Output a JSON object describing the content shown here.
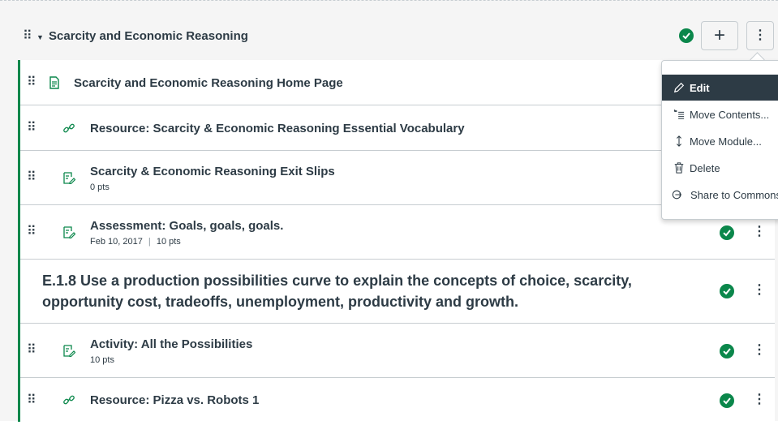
{
  "module": {
    "title": "Scarcity and Economic Reasoning",
    "add_label": "+",
    "more_label": "⋮"
  },
  "items": [
    {
      "title": "Scarcity and Economic Reasoning Home Page",
      "type": "page-icon",
      "meta": ""
    },
    {
      "title": "Resource: Scarcity & Economic Reasoning Essential Vocabulary",
      "type": "link-icon",
      "meta": ""
    },
    {
      "title": "Scarcity & Economic Reasoning Exit Slips",
      "type": "assignment-icon",
      "meta": "0 pts"
    },
    {
      "title": "Assessment: Goals, goals, goals.",
      "type": "assignment-icon",
      "meta_date": "Feb 10, 2017",
      "meta_sep": "|",
      "meta_pts": "10 pts"
    },
    {
      "title": "E.1.8 Use a production possibilities curve to explain the concepts of choice, scarcity, opportunity cost, tradeoffs, unemployment, productivity and growth.",
      "type": "header"
    },
    {
      "title": "Activity: All the Possibilities",
      "type": "assignment-icon",
      "meta": "10 pts"
    },
    {
      "title": "Resource: Pizza vs. Robots 1",
      "type": "link-icon",
      "meta": ""
    }
  ],
  "menu": {
    "items": [
      {
        "label": "Edit",
        "icon": "pencil-icon"
      },
      {
        "label": "Move Contents...",
        "icon": "move-contents-icon"
      },
      {
        "label": "Move Module...",
        "icon": "up-down-arrow-icon"
      },
      {
        "label": "Delete",
        "icon": "trash-icon"
      },
      {
        "label": "Share to Commons",
        "icon": "share-commons-icon"
      }
    ]
  },
  "kebab": "⋮",
  "colors": {
    "published": "#0b874b",
    "text": "#2d3b45",
    "border": "#c7cdd1",
    "menu_active": "#2d3b45"
  }
}
